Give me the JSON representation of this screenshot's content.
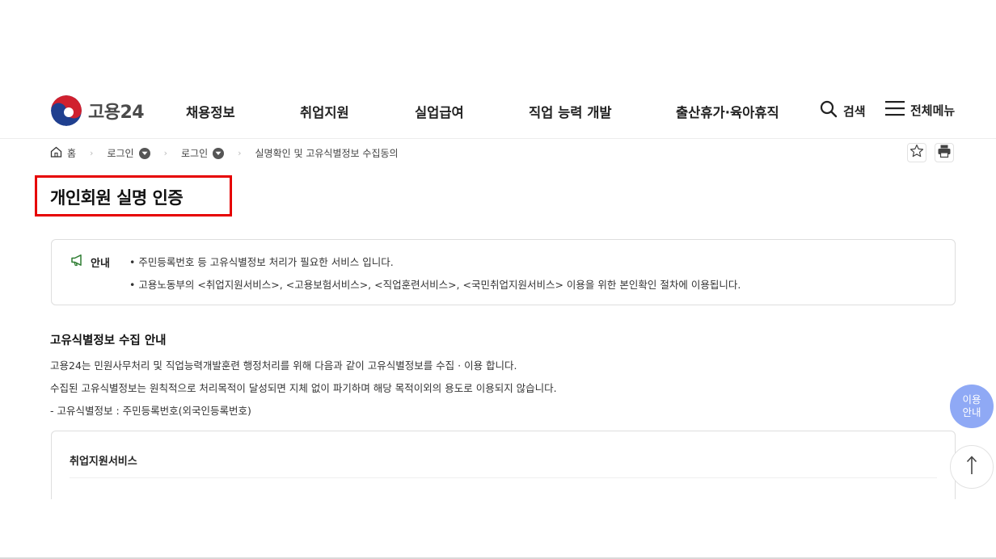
{
  "header": {
    "logo_text": "고용24",
    "nav": [
      "채용정보",
      "취업지원",
      "실업급여",
      "직업 능력 개발",
      "출산휴가·육아휴직"
    ],
    "search_label": "검색",
    "menu_label": "전체메뉴"
  },
  "breadcrumb": {
    "home": "홈",
    "level1": "로그인",
    "level2": "로그인",
    "current": "실명확인 및 고유식별정보 수집동의"
  },
  "page": {
    "title": "개인회원 실명 인증"
  },
  "notice": {
    "label": "안내",
    "lines": [
      "• 주민등록번호 등 고유식별정보 처리가 필요한 서비스 입니다.",
      "• 고용노동부의 <취업지원서비스>, <고용보험서비스>, <직업훈련서비스>, <국민취업지원서비스> 이용을 위한 본인확인 절차에 이용됩니다."
    ]
  },
  "collection": {
    "title": "고유식별정보 수집 안내",
    "paragraphs": [
      "고용24는 민원사무처리 및 직업능력개발훈련 행정처리를 위해 다음과 같이 고유식별정보를 수집 · 이용 합니다.",
      "수집된 고유식별정보는 원칙적으로 처리목적이 달성되면 지체 없이 파기하며 해당 목적이외의 용도로 이용되지 않습니다.",
      "- 고유식별정보 : 주민등록번호(외국인등록번호)"
    ]
  },
  "service_box": {
    "title": "취업지원서비스"
  },
  "floating": {
    "guide_line1": "이용",
    "guide_line2": "안내",
    "top_arrow": "↑"
  },
  "colors": {
    "highlight_border": "#e60000",
    "guide_button": "#8fa9f5",
    "notice_icon": "#2e7d32"
  },
  "icons": [
    "home-icon",
    "star-icon",
    "print-icon",
    "search-icon",
    "hamburger-icon",
    "megaphone-icon",
    "chevron-down-icon",
    "arrow-up-icon"
  ]
}
